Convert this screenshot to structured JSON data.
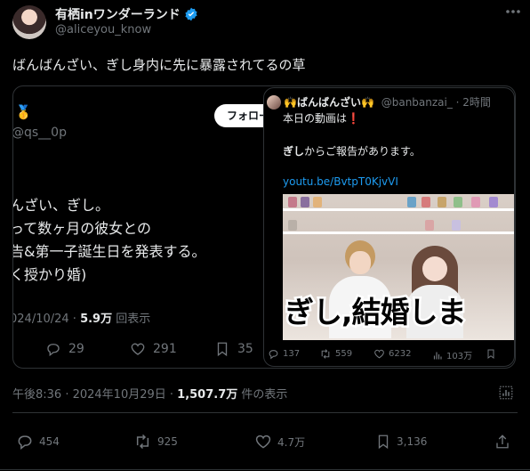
{
  "header": {
    "display_name": "有栖inワンダーランド",
    "handle": "@aliceyou_know",
    "verified_icon": "verified-badge-icon",
    "more_icon": "more-icon"
  },
  "tweet": {
    "text": "ばんばんざい、ぎし身内に先に暴露されてるの草",
    "timestamp": "午後8:36 · 2024年10月29日 · ",
    "views_count": "1,507.7万",
    "views_label": " 件の表示"
  },
  "quoted": {
    "medal": "🥇",
    "handle": "@qs__0p",
    "follow_label": "フォロー",
    "lines": [
      "んざい、ぎし。",
      "って数ヶ月の彼女との",
      "告&第一子誕生日を発表する。",
      "く授かり婚)"
    ],
    "date": "024/10/24 · ",
    "views_count": "5.9万",
    "views_label": " 回表示",
    "replies": "29",
    "likes": "291",
    "bookmarks": "35"
  },
  "inner": {
    "display_name": "🙌ばんばんざい🙌",
    "handle_time": "@banbanzai_ · 2時間",
    "line1": "本日の動画は",
    "exclaim": "❗",
    "line2_name": "ぎし",
    "line2_rest": "からご報告があります。",
    "link": "youtu.be/BvtpT0KjvVI",
    "thumb_caption": "ぎし,結婚しま",
    "replies": "137",
    "retweets": "559",
    "likes": "6232",
    "views": "103万"
  },
  "actions": {
    "replies": "454",
    "retweets": "925",
    "likes": "4.7万",
    "bookmarks": "3,136"
  },
  "colors": {
    "background": "#000000",
    "text": "#e7e9ea",
    "muted": "#71767b",
    "link": "#1d9bf0",
    "border": "#2f3336",
    "verified": "#1d9bf0"
  }
}
